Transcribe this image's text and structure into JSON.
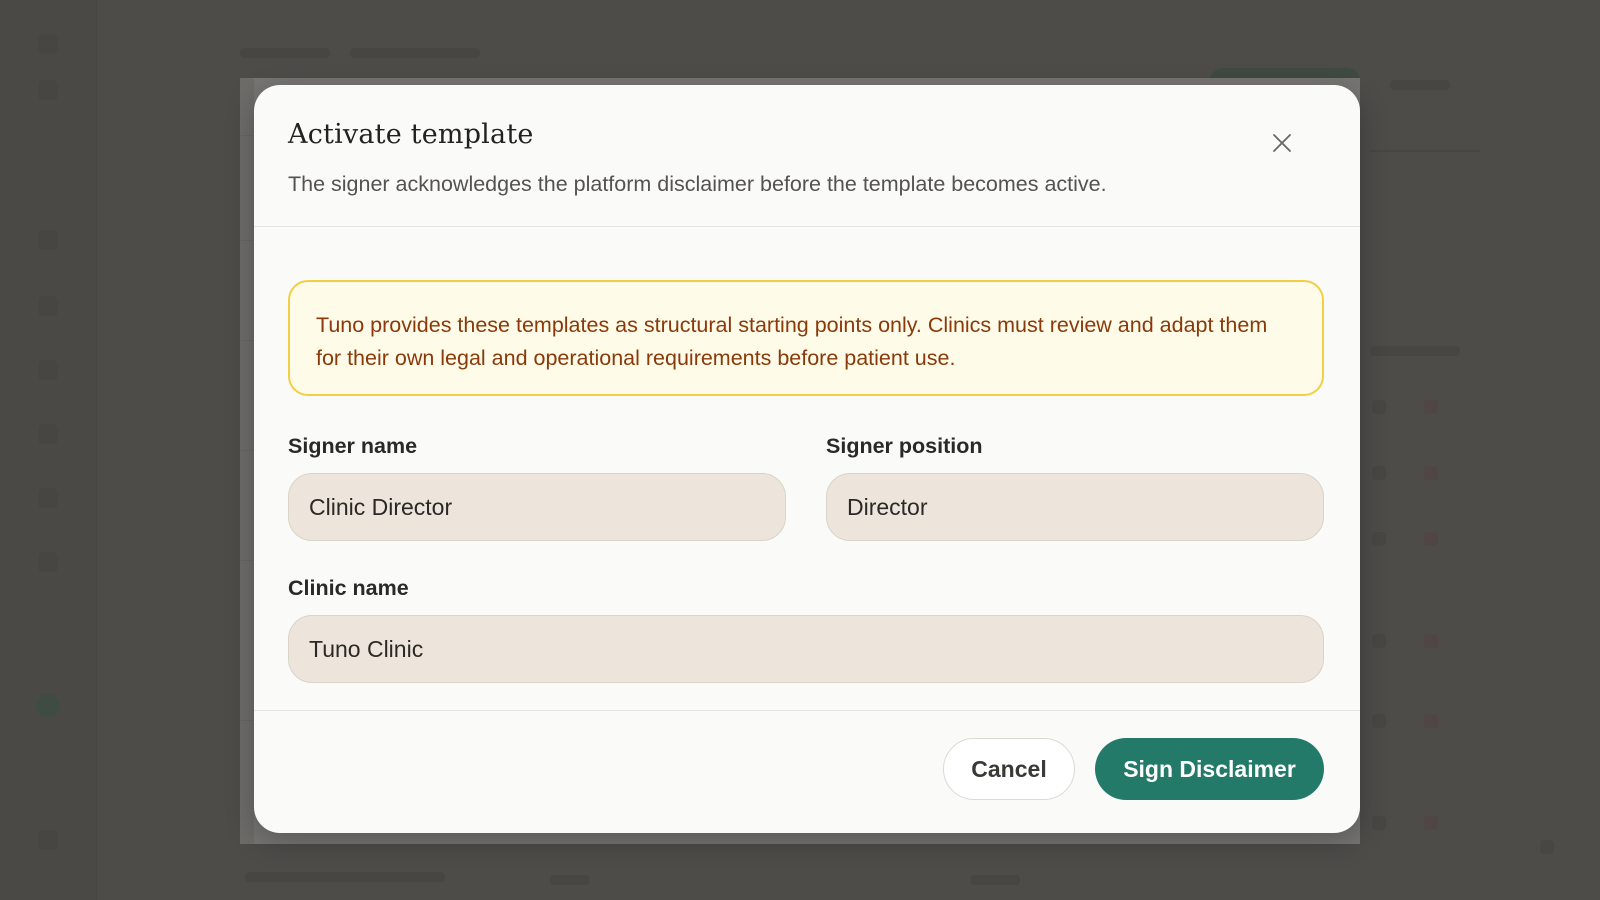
{
  "modal": {
    "title": "Activate template",
    "subtitle": "The signer acknowledges the platform disclaimer before the template becomes active.",
    "close_icon": "close-icon"
  },
  "notice": {
    "text": "Tuno provides these templates as structural starting points only. Clinics must review and adapt them for their own legal and operational requirements before patient use."
  },
  "form": {
    "signer_name": {
      "label": "Signer name",
      "value": "Clinic Director"
    },
    "signer_position": {
      "label": "Signer position",
      "value": "Director"
    },
    "clinic_name": {
      "label": "Clinic name",
      "value": "Tuno Clinic"
    }
  },
  "footer": {
    "cancel_label": "Cancel",
    "submit_label": "Sign Disclaimer"
  },
  "colors": {
    "primary": "#237a68",
    "notice_bg": "#fffbe9",
    "notice_border": "#f2cf45",
    "notice_text": "#8a3a0a",
    "input_bg": "#ede5dc",
    "overlay": "#4b4a47"
  }
}
